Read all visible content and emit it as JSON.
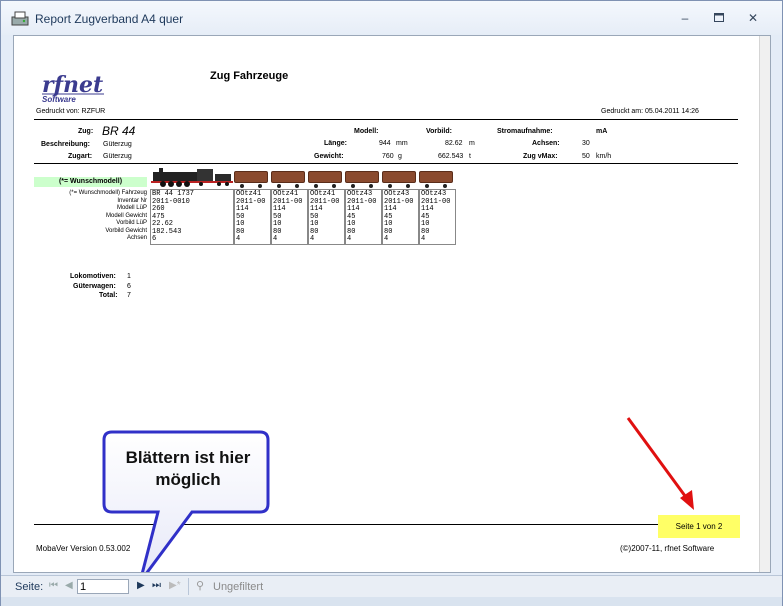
{
  "window": {
    "title": "Report Zugverband A4 quer",
    "min_icon": "minimize-icon",
    "max_icon": "maximize-icon",
    "close_icon": "close-icon"
  },
  "header": {
    "report_title": "Zug Fahrzeuge",
    "printed_by": "Gedruckt von: RZFUR",
    "printed_at": "Gedruckt am: 05.04.2011 14:26"
  },
  "logo": {
    "main": "rfnet",
    "sub": "Software"
  },
  "info": {
    "zug_label": "Zug:",
    "zug_value": "BR 44",
    "beschreibung_label": "Beschreibung:",
    "beschreibung_value": "Güterzug",
    "zugart_label": "Zugart:",
    "zugart_value": "Güterzug",
    "modell_label": "Modell:",
    "vorbild_label": "Vorbild:",
    "laenge_label": "Länge:",
    "laenge_modell": "944",
    "laenge_unit_modell": "mm",
    "laenge_vorbild": "82.62",
    "laenge_unit_vorbild": "m",
    "gewicht_label": "Gewicht:",
    "gewicht_modell": "760",
    "gewicht_unit": "g",
    "gewicht_vorbild": "662.543",
    "gewicht_unit_vorbild": "t",
    "strom_label": "Stromaufnahme:",
    "strom_unit": "mA",
    "achsen_label": "Achsen:",
    "achsen_value": "30",
    "vmax_label": "Zug vMax:",
    "vmax_value": "50",
    "vmax_unit": "km/h"
  },
  "wunsch_banner": "(*= Wunschmodell)",
  "row_labels": [
    "(*= Wunschmodell) Fahrzeug",
    "Inventar Nr",
    "Modell LüP",
    "Modell Gewicht",
    "Vorbild LüP",
    "Vorbild Gewicht",
    "Achsen"
  ],
  "vehicles": [
    {
      "rows": [
        "BR 44 1737",
        "2011-0010",
        "260",
        "475",
        "22.62",
        "182.543",
        "6"
      ]
    },
    {
      "rows": [
        "OOtz41",
        "2011-00",
        "114",
        "50",
        "10",
        "80",
        "4"
      ]
    },
    {
      "rows": [
        "OOtz41",
        "2011-00",
        "114",
        "50",
        "10",
        "80",
        "4"
      ]
    },
    {
      "rows": [
        "OOtz41",
        "2011-00",
        "114",
        "50",
        "10",
        "80",
        "4"
      ]
    },
    {
      "rows": [
        "OOtz43",
        "2011-00",
        "114",
        "45",
        "10",
        "80",
        "4"
      ]
    },
    {
      "rows": [
        "OOtz43",
        "2011-00",
        "114",
        "45",
        "10",
        "80",
        "4"
      ]
    },
    {
      "rows": [
        "OOtz43",
        "2011-00",
        "114",
        "45",
        "10",
        "80",
        "4"
      ]
    }
  ],
  "totals": {
    "lok_label": "Lokomotiven:",
    "lok_value": "1",
    "gueter_label": "Güterwagen:",
    "gueter_value": "6",
    "total_label": "Total:",
    "total_value": "7"
  },
  "footer": {
    "version": "MobaVer Version 0.53.002",
    "copyright": "(©)2007-11, rfnet Software",
    "page_indicator": "Seite 1 von 2"
  },
  "callout": {
    "text_line1": "Blättern ist hier",
    "text_line2": "möglich"
  },
  "navbar": {
    "seite_label": "Seite:",
    "page_value": "1",
    "filter_label": "Ungefiltert"
  },
  "colors": {
    "highlight_yellow": "#ffff66",
    "wunsch_green": "#ccffcc",
    "callout_blue": "#3030c8",
    "arrow_red": "#e01010"
  }
}
